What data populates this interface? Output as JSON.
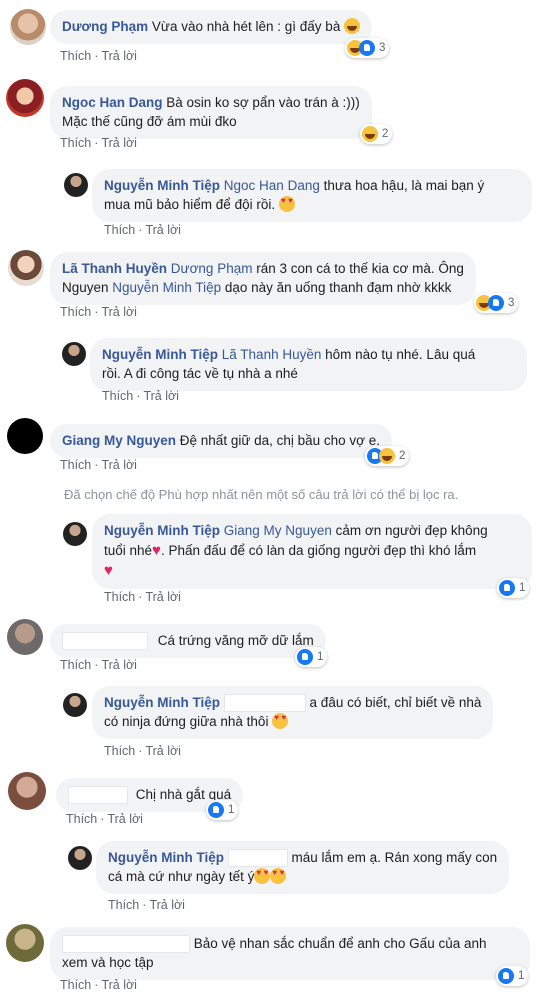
{
  "actions": {
    "like": "Thích",
    "reply": "Trả lời",
    "sep": "·"
  },
  "filter_note": "Đã chọn chế độ Phù hợp nhất nên một số câu trả lời có thể bị lọc ra.",
  "comments": [
    {
      "name": "Dương Phạm",
      "text": "Vừa vào nhà hét lên : gì đấy bà",
      "reactions": [
        "haha",
        "like"
      ],
      "count": "3"
    },
    {
      "name": "Ngoc Han Dang",
      "text1": "Bà osin ko sợ pẩn vào trán à :)))",
      "text2": "Mặc thế cũng đỡ ám mùi đko",
      "reactions": [
        "haha"
      ],
      "count": "2"
    },
    {
      "name": "Nguyễn Minh Tiệp",
      "mention": "Ngoc Han Dang",
      "text1": " thưa hoa hậu, là mai bạn ý",
      "text2": "mua mũ bảo hiểm để đội rồi."
    },
    {
      "name": "Lã Thanh Huyền",
      "mention": "Dương Phạm",
      "text1": " rán 3 con cá to thế kia cơ mà. Ông",
      "text2a": "Nguyen ",
      "mention2": "Nguyễn Minh Tiệp",
      "text2b": " dạo này ăn uống thanh đạm nhờ kkkk",
      "reactions": [
        "haha",
        "like"
      ],
      "count": "3"
    },
    {
      "name": "Nguyễn Minh Tiệp",
      "mention": "Lã Thanh Huyền",
      "text1": " hôm nào tụ nhé. Lâu quá",
      "text2": "rồi. A đi công tác về tụ nhà a nhé"
    },
    {
      "name": "Giang My Nguyen",
      "text": "Đệ nhất giữ da, chị bầu cho vợ e.",
      "reactions": [
        "like",
        "haha"
      ],
      "count": "2"
    },
    {
      "name": "Nguyễn Minh Tiệp",
      "mention": "Giang My Nguyen",
      "text1": " cảm ơn người đẹp không",
      "text2": "tuổi nhé",
      "text2b": ". Phấn đấu để có làn da giống người đẹp thì khó lắm",
      "reactions": [
        "like"
      ],
      "count": "1"
    },
    {
      "text": "Cá trứng văng mỡ dữ lắm",
      "reactions": [
        "like"
      ],
      "count": "1"
    },
    {
      "name": "Nguyễn Minh Tiệp",
      "text1": "a đâu có biết, chỉ biết về nhà",
      "text2": "có ninja đứng giữa nhà thôi"
    },
    {
      "text": "Chị nhà gắt quá",
      "reactions": [
        "like"
      ],
      "count": "1"
    },
    {
      "name": "Nguyễn Minh Tiệp",
      "text1": "máu lắm em ạ. Rán xong mấy con",
      "text2": "cá mà cứ như ngày tết ý"
    },
    {
      "text1": "Bảo vệ nhan sắc chuẩn để anh cho Gấu của anh",
      "text2": "xem và học tập",
      "reactions": [
        "like"
      ],
      "count": "1"
    }
  ],
  "colors": {
    "link": "#385898",
    "bubble": "#f2f3f5",
    "meta": "#606770",
    "like": "#1877f2",
    "haha": "#f7c23e"
  }
}
